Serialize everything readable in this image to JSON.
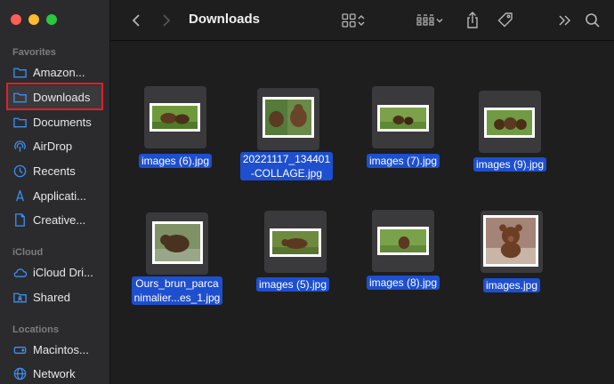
{
  "window": {
    "title": "Downloads"
  },
  "sidebar": {
    "favorites_title": "Favorites",
    "favorites": [
      {
        "label": "Amazon...",
        "icon": "folder-icon"
      },
      {
        "label": "Downloads",
        "icon": "folder-icon"
      },
      {
        "label": "Documents",
        "icon": "folder-icon"
      },
      {
        "label": "AirDrop",
        "icon": "airdrop-icon"
      },
      {
        "label": "Recents",
        "icon": "clock-icon"
      },
      {
        "label": "Applicati...",
        "icon": "applications-icon"
      },
      {
        "label": "Creative...",
        "icon": "document-icon"
      }
    ],
    "icloud_title": "iCloud",
    "icloud": [
      {
        "label": "iCloud Dri...",
        "icon": "cloud-icon"
      },
      {
        "label": "Shared",
        "icon": "shared-folder-icon"
      }
    ],
    "locations_title": "Locations",
    "locations": [
      {
        "label": "Macintos...",
        "icon": "disk-icon"
      },
      {
        "label": "Network",
        "icon": "globe-icon"
      }
    ]
  },
  "files": [
    {
      "label": "images (6).jpg"
    },
    {
      "label_line1": "20221117_134401",
      "label_line2": "-COLLAGE.jpg"
    },
    {
      "label": "images (7).jpg"
    },
    {
      "label": "images (9).jpg"
    },
    {
      "label_line1": "Ours_brun_parca",
      "label_line2": "nimalier...es_1.jpg"
    },
    {
      "label": "images (5).jpg"
    },
    {
      "label": "images (8).jpg"
    },
    {
      "label": "images.jpg"
    }
  ],
  "colors": {
    "accent": "#1d4fcf",
    "highlight": "#e21e2b",
    "folder": "#3d8ff5"
  }
}
